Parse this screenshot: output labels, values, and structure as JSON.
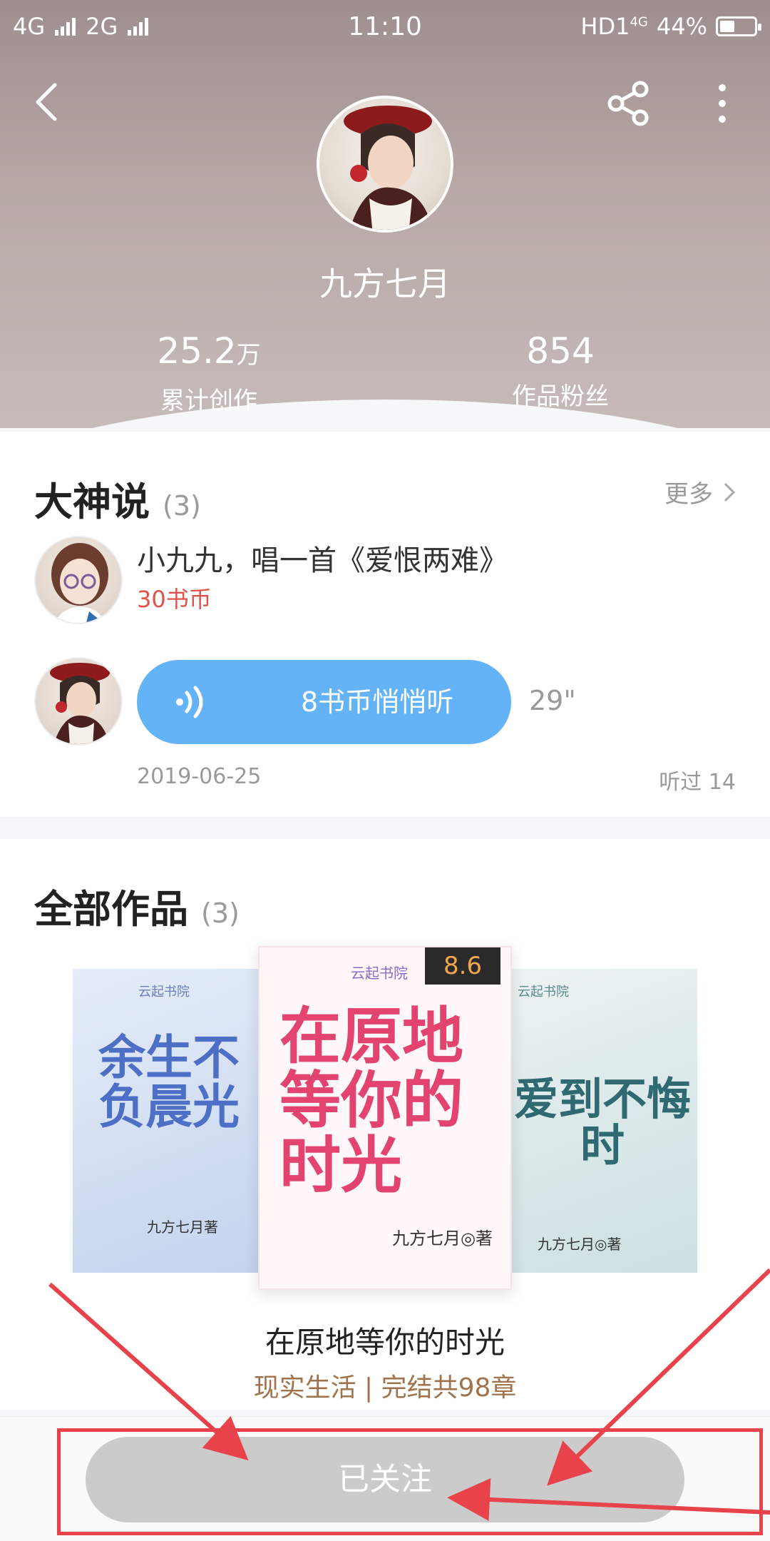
{
  "status_bar": {
    "network_left": "4G",
    "network_right": "2G",
    "time": "11:10",
    "hd_label": "HD1",
    "hd_sub": "4G",
    "battery": "44%",
    "battery_level": 0.44
  },
  "header": {
    "author_name": "九方七月",
    "stats": [
      {
        "value": "25.2",
        "unit": "万",
        "label": "累计创作"
      },
      {
        "value": "854",
        "unit": "",
        "label": "作品粉丝"
      }
    ]
  },
  "dashen_shuo": {
    "title": "大神说",
    "count": "(3)",
    "more": "更多",
    "post": {
      "text": "小九九，唱一首《爱恨两难》",
      "coins": "30书币"
    },
    "reply": {
      "voice_label": "8书币悄悄听",
      "duration": "29\"",
      "date": "2019-06-25",
      "listen_count": "听过 14"
    }
  },
  "works": {
    "title": "全部作品",
    "count": "(3)",
    "books": [
      {
        "cover_title": "余生不负晨光",
        "publisher": "云起书院",
        "author": "九方七月著"
      },
      {
        "cover_title": "在原地等你的时光",
        "publisher": "云起书院",
        "author": "九方七月◎著",
        "score": "8.6"
      },
      {
        "cover_title": "爱到不悔时",
        "publisher": "云起书院",
        "author": "九方七月◎著"
      }
    ],
    "selected_name": "在原地等你的时光",
    "selected_meta": "现实生活 | 完结共98章"
  },
  "bottom": {
    "follow_label": "已关注"
  },
  "colors": {
    "accent_blue": "#63b3f6",
    "coin_red": "#e0524a",
    "meta_brown": "#a0734c",
    "annotation_red": "#e8424a"
  }
}
